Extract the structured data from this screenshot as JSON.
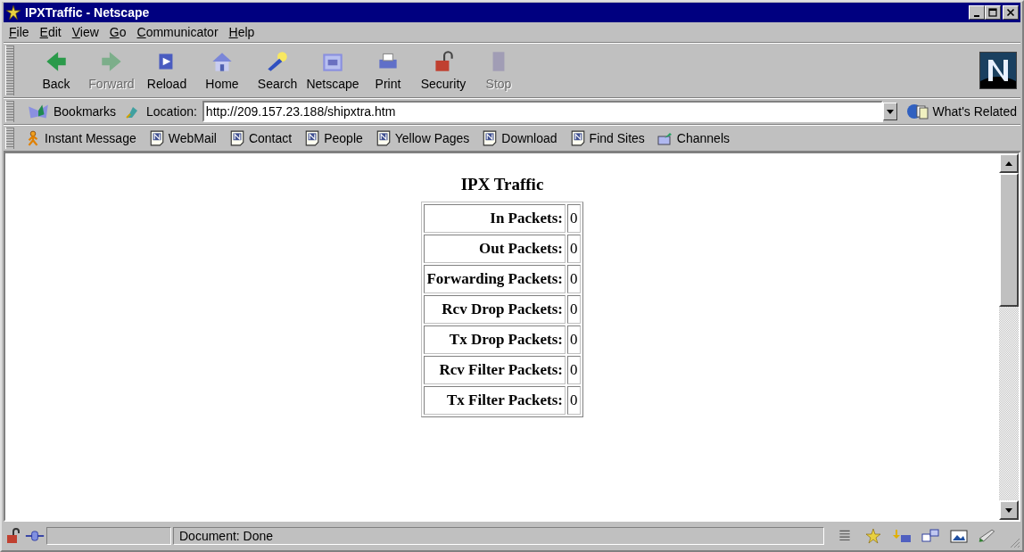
{
  "window": {
    "title": "IPXTraffic - Netscape"
  },
  "menu": [
    {
      "label": "File"
    },
    {
      "label": "Edit"
    },
    {
      "label": "View"
    },
    {
      "label": "Go"
    },
    {
      "label": "Communicator"
    },
    {
      "label": "Help"
    }
  ],
  "toolbar": [
    {
      "label": "Back",
      "disabled": false
    },
    {
      "label": "Forward",
      "disabled": true
    },
    {
      "label": "Reload",
      "disabled": false
    },
    {
      "label": "Home",
      "disabled": false
    },
    {
      "label": "Search",
      "disabled": false
    },
    {
      "label": "Netscape",
      "disabled": false
    },
    {
      "label": "Print",
      "disabled": false
    },
    {
      "label": "Security",
      "disabled": false
    },
    {
      "label": "Stop",
      "disabled": true
    }
  ],
  "location_bar": {
    "bookmarks": "Bookmarks",
    "label": "Location:",
    "url": "http://209.157.23.188/shipxtra.htm",
    "whats_related": "What's Related"
  },
  "personal_bar": [
    {
      "label": "Instant Message",
      "kind": "person"
    },
    {
      "label": "WebMail",
      "kind": "page"
    },
    {
      "label": "Contact",
      "kind": "page"
    },
    {
      "label": "People",
      "kind": "page"
    },
    {
      "label": "Yellow Pages",
      "kind": "page"
    },
    {
      "label": "Download",
      "kind": "page"
    },
    {
      "label": "Find Sites",
      "kind": "page"
    },
    {
      "label": "Channels",
      "kind": "channel"
    }
  ],
  "page": {
    "heading": "IPX Traffic",
    "rows": [
      {
        "label": "In Packets:",
        "value": "0"
      },
      {
        "label": "Out Packets:",
        "value": "0"
      },
      {
        "label": "Forwarding Packets:",
        "value": "0"
      },
      {
        "label": "Rcv Drop Packets:",
        "value": "0"
      },
      {
        "label": "Tx Drop Packets:",
        "value": "0"
      },
      {
        "label": "Rcv Filter Packets:",
        "value": "0"
      },
      {
        "label": "Tx Filter Packets:",
        "value": "0"
      }
    ]
  },
  "status_bar": {
    "text": "Document: Done"
  }
}
